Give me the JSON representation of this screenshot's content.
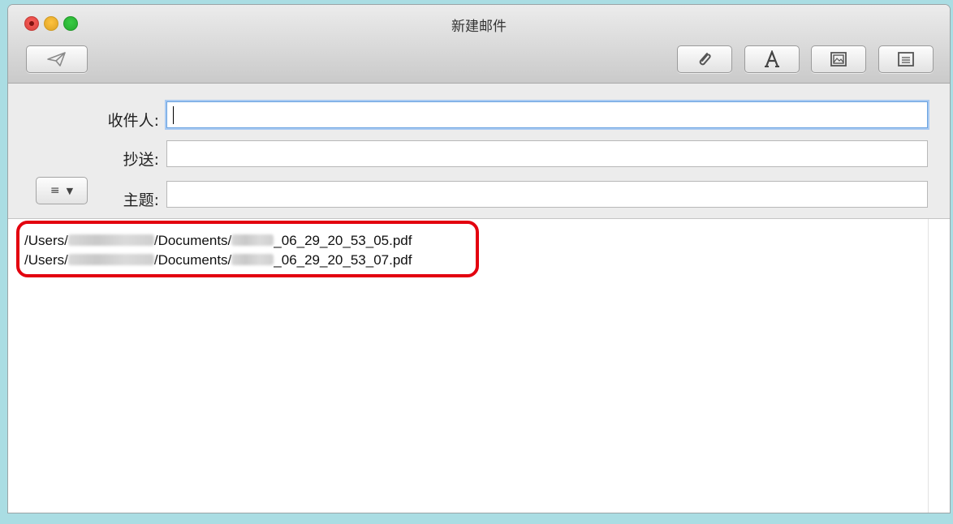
{
  "window": {
    "title": "新建邮件"
  },
  "toolbar": {
    "send_icon": "paper-plane-icon",
    "attach_icon": "paperclip-icon",
    "font_icon": "letter-a-icon",
    "photo_icon": "photo-browser-icon",
    "stationery_icon": "stationery-icon"
  },
  "fields": {
    "to_label": "收件人:",
    "to_value": "",
    "cc_label": "抄送:",
    "cc_value": "",
    "subject_label": "主题:",
    "subject_value": "",
    "format_menu_icon": "list-icon"
  },
  "attachments": [
    {
      "prefix": "/Users/",
      "mid": "/Documents/",
      "suffix": "_06_29_20_53_05.pdf"
    },
    {
      "prefix": "/Users/",
      "mid": "/Documents/",
      "suffix": "_06_29_20_53_07.pdf"
    }
  ],
  "colors": {
    "highlight": "#e3000f",
    "focus_ring": "#a9caf2",
    "background": "#aadde3"
  }
}
